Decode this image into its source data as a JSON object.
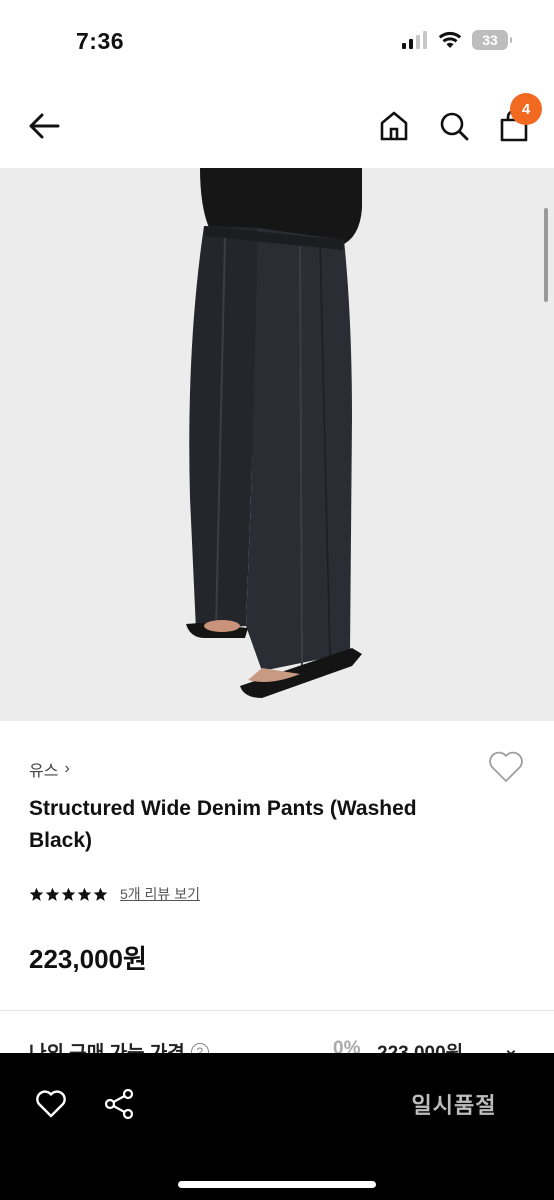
{
  "status_bar": {
    "time": "7:36",
    "battery_level": "33"
  },
  "nav": {
    "back_icon": "arrow-left-icon",
    "home_icon": "home-icon",
    "search_icon": "search-icon",
    "bag_icon": "shopping-bag-icon",
    "cart_count": "4",
    "badge_color": "#f26a21"
  },
  "product": {
    "brand": "유스",
    "brand_chevron": "›",
    "title": "Structured Wide Denim Pants (Washed Black)",
    "rating_stars": 5,
    "review_link": "5개 리뷰 보기",
    "price": "223,000원"
  },
  "my_price": {
    "label": "나의 구매 가능 가격",
    "help": "?",
    "discount": "0%",
    "value": "223,000원",
    "chevron": "⌄"
  },
  "bottom_bar": {
    "wish_icon": "heart-outline-icon",
    "share_icon": "share-icon",
    "soldout_label": "일시품절"
  }
}
